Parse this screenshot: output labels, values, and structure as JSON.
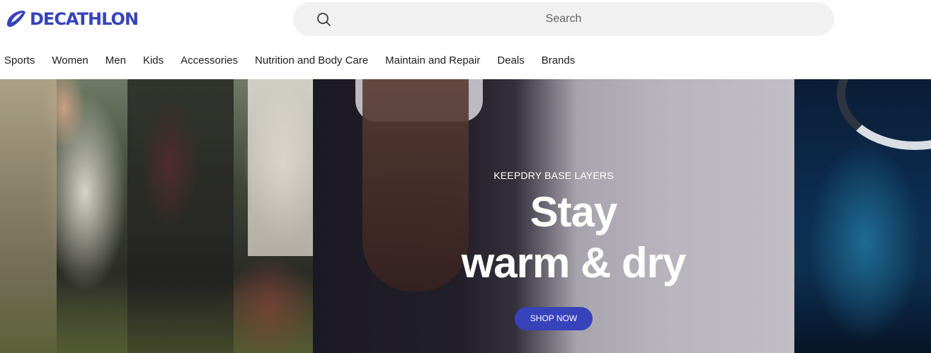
{
  "brand": {
    "name": "DECATHLON",
    "color": "#3643ba"
  },
  "search": {
    "placeholder": "Search",
    "icon": "search-icon"
  },
  "nav": {
    "items": [
      {
        "label": "Sports"
      },
      {
        "label": "Women"
      },
      {
        "label": "Men"
      },
      {
        "label": "Kids"
      },
      {
        "label": "Accessories"
      },
      {
        "label": "Nutrition and Body Care"
      },
      {
        "label": "Maintain and Repair"
      },
      {
        "label": "Deals"
      },
      {
        "label": "Brands"
      }
    ]
  },
  "hero": {
    "eyebrow": "KEEPDRY BASE LAYERS",
    "headline_line1": "Stay",
    "headline_line2": "warm & dry",
    "cta_label": "SHOP NOW",
    "cta_color": "#3643ba"
  }
}
